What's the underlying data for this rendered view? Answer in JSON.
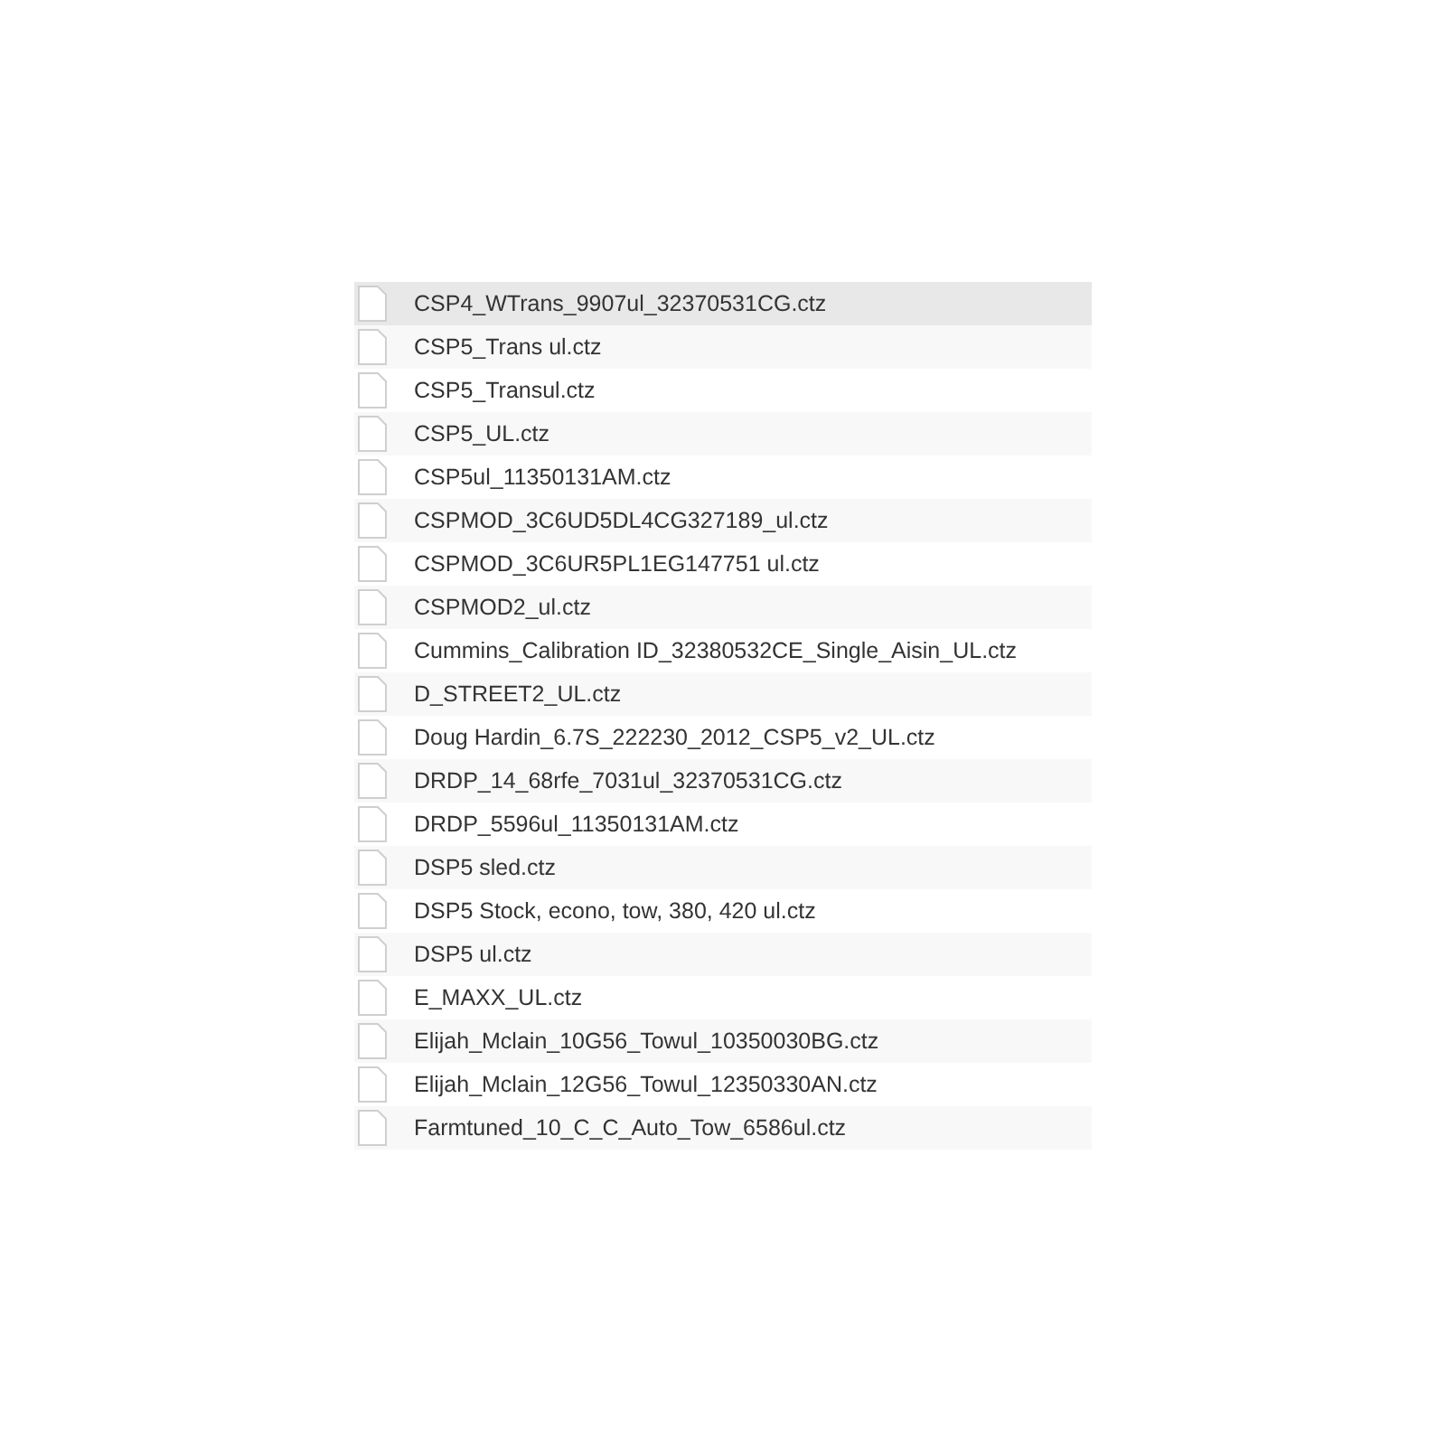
{
  "files": [
    {
      "name": "CSP4_WTrans_9907ul_32370531CG.ctz",
      "selected": true
    },
    {
      "name": "CSP5_Trans ul.ctz",
      "selected": false
    },
    {
      "name": "CSP5_Transul.ctz",
      "selected": false
    },
    {
      "name": "CSP5_UL.ctz",
      "selected": false
    },
    {
      "name": "CSP5ul_11350131AM.ctz",
      "selected": false
    },
    {
      "name": "CSPMOD_3C6UD5DL4CG327189_ul.ctz",
      "selected": false
    },
    {
      "name": "CSPMOD_3C6UR5PL1EG147751 ul.ctz",
      "selected": false
    },
    {
      "name": "CSPMOD2_ul.ctz",
      "selected": false
    },
    {
      "name": "Cummins_Calibration ID_32380532CE_Single_Aisin_UL.ctz",
      "selected": false
    },
    {
      "name": "D_STREET2_UL.ctz",
      "selected": false
    },
    {
      "name": "Doug Hardin_6.7S_222230_2012_CSP5_v2_UL.ctz",
      "selected": false
    },
    {
      "name": "DRDP_14_68rfe_7031ul_32370531CG.ctz",
      "selected": false
    },
    {
      "name": "DRDP_5596ul_11350131AM.ctz",
      "selected": false
    },
    {
      "name": "DSP5 sled.ctz",
      "selected": false
    },
    {
      "name": "DSP5 Stock, econo, tow, 380, 420 ul.ctz",
      "selected": false
    },
    {
      "name": "DSP5 ul.ctz",
      "selected": false
    },
    {
      "name": "E_MAXX_UL.ctz",
      "selected": false
    },
    {
      "name": "Elijah_Mclain_10G56_Towul_10350030BG.ctz",
      "selected": false
    },
    {
      "name": "Elijah_Mclain_12G56_Towul_12350330AN.ctz",
      "selected": false
    },
    {
      "name": "Farmtuned_10_C_C_Auto_Tow_6586ul.ctz",
      "selected": false
    }
  ]
}
